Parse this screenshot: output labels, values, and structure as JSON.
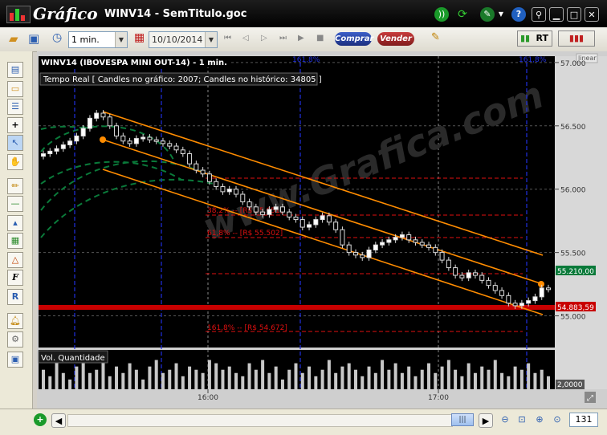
{
  "app": {
    "name": "Gráfico",
    "window_title": "WINV14 - SemTitulo.goc"
  },
  "toolbar": {
    "interval": "1 min.",
    "date": "10/10/2014",
    "buy_label": "Comprar",
    "sell_label": "Vender",
    "rt_label": "RT"
  },
  "chart": {
    "title": "WINV14 (IBOVESPA MINI OUT-14) - 1 min.",
    "info": "Tempo Real  [ Candles no gráfico: 2007; Candles no histórico: 34805 ]",
    "scale_mode": "linear",
    "price_ticks": [
      "57.000",
      "56.500",
      "56.000",
      "55.500",
      "55.000"
    ],
    "current_price_label": "55.210,00",
    "support_price_label": "54.883,59",
    "fib_labels": {
      "top_left": "161,8%",
      "top_right": "161,8%",
      "fib_382": "38,2% -- [R$ 55.651]",
      "fib_618": "61,8% -- [R$ 55.502]",
      "fib_1618": "161,8% -- [R$ 54.672]"
    },
    "watermark": "www.Grafica.com"
  },
  "volume": {
    "label": "Vol. Quantidade",
    "scale_label": "2,0000"
  },
  "time_axis": {
    "ticks": [
      "16:00",
      "17:00"
    ]
  },
  "bottom": {
    "zoom_value": "131"
  },
  "chart_data": {
    "type": "candlestick",
    "title": "WINV14 (IBOVESPA MINI OUT-14) - 1 min.",
    "x_ticks": [
      "16:00",
      "17:00"
    ],
    "y_ticks": [
      57000,
      56500,
      56000,
      55500,
      55000
    ],
    "ylim": [
      54750,
      57050
    ],
    "close_prices": [
      56280,
      56300,
      56320,
      56350,
      56380,
      56420,
      56480,
      56560,
      56600,
      56570,
      56500,
      56420,
      56380,
      56360,
      56400,
      56410,
      56390,
      56380,
      56360,
      56340,
      56310,
      56280,
      56200,
      56150,
      56120,
      56060,
      56020,
      55980,
      56000,
      55960,
      55900,
      55860,
      55820,
      55800,
      55840,
      55860,
      55820,
      55780,
      55760,
      55700,
      55720,
      55760,
      55790,
      55740,
      55680,
      55560,
      55500,
      55480,
      55460,
      55520,
      55560,
      55580,
      55600,
      55620,
      55640,
      55600,
      55580,
      55560,
      55540,
      55500,
      55440,
      55380,
      55320,
      55300,
      55340,
      55320,
      55280,
      55240,
      55200,
      55160,
      55100,
      55080,
      55100,
      55120,
      55150,
      55220,
      55210
    ],
    "current_price": 55210,
    "support_level": 54883.59,
    "fibonacci": [
      {
        "level": "38,2%",
        "price": 55651
      },
      {
        "level": "61,8%",
        "price": 55502
      },
      {
        "level": "161,8%",
        "price": 54672
      }
    ],
    "volume_label": "Vol. Quantidade",
    "volume_scale": 2.0,
    "volume_values": [
      0.6,
      0.4,
      0.9,
      0.5,
      0.3,
      0.7,
      0.8,
      0.5,
      0.6,
      0.9,
      0.4,
      0.7,
      0.5,
      0.8,
      0.6,
      0.3,
      0.7,
      0.9,
      0.5,
      0.6,
      0.8,
      0.4,
      0.7,
      0.6,
      0.5,
      0.9,
      0.8,
      0.6,
      0.7,
      0.5,
      0.4,
      0.8,
      0.6,
      0.9,
      0.5,
      0.7,
      0.3,
      0.6,
      0.8,
      0.5,
      0.7,
      0.4,
      0.6,
      0.9,
      0.5,
      0.7,
      0.8,
      0.6,
      0.4,
      0.7,
      0.5,
      0.9,
      0.6,
      0.8,
      0.5,
      0.7,
      0.4,
      0.6,
      0.8,
      0.5,
      0.7,
      0.9,
      0.6,
      0.4,
      0.8,
      0.5,
      0.7,
      0.6,
      0.9,
      0.5,
      0.4,
      0.7,
      0.6,
      0.8,
      0.5,
      0.6,
      0.4
    ]
  },
  "colors": {
    "background": "#000000",
    "channel": "#ff8c00",
    "fib": "#e01010",
    "grid": "#3a3a3a",
    "arcs": "#0a7a3a",
    "cycles": "#2030e0"
  }
}
